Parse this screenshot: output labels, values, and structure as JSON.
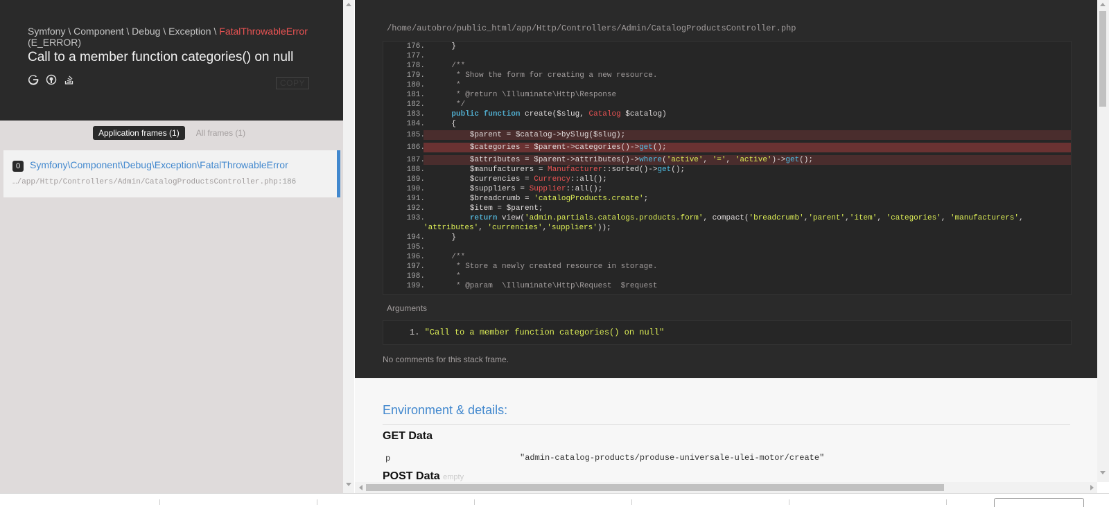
{
  "header": {
    "namespace": "Symfony \\ Component \\ Debug \\ Exception \\ ",
    "exception_name": "FatalThrowableError",
    "error_code": "(E_ERROR)",
    "message": "Call to a member function categories() on null",
    "copy_label": "COPY",
    "search_icons": [
      "google-icon",
      "duckduckgo-icon",
      "stackoverflow-icon"
    ]
  },
  "frame_tabs": {
    "application": "Application frames (1)",
    "all": "All frames (1)"
  },
  "frame": {
    "index": "0",
    "class": "Symfony\\Component\\Debug\\Exception\\FatalThrowableError",
    "file": "…/app/Http/Controllers/Admin/CatalogProductsController.php",
    "line": ":186"
  },
  "code": {
    "file_path": "/home/autobro/public_html/app/Http/Controllers/Admin/CatalogProductsController.php",
    "lines": [
      {
        "num": "176.",
        "text": "    }"
      },
      {
        "num": "177.",
        "text": ""
      },
      {
        "num": "178.",
        "text": "    /**"
      },
      {
        "num": "179.",
        "text": "     * Show the form for creating a new resource."
      },
      {
        "num": "180.",
        "text": "     *"
      },
      {
        "num": "181.",
        "text": "     * @return \\Illuminate\\Http\\Response"
      },
      {
        "num": "182.",
        "text": "     */"
      },
      {
        "num": "183.",
        "text": "    public function create($slug, Catalog $catalog)"
      },
      {
        "num": "184.",
        "text": "    {"
      },
      {
        "num": "185.",
        "text": "        $parent = $catalog->bySlug($slug);"
      },
      {
        "num": "186.",
        "text": "        $categories = $parent->categories()->get();"
      },
      {
        "num": "187.",
        "text": "        $attributes = $parent->attributes()->where('active', '=', 'active')->get();"
      },
      {
        "num": "188.",
        "text": "        $manufacturers = Manufacturer::sorted()->get();"
      },
      {
        "num": "189.",
        "text": "        $currencies = Currency::all();"
      },
      {
        "num": "190.",
        "text": "        $suppliers = Supplier::all();"
      },
      {
        "num": "191.",
        "text": "        $breadcrumb = 'catalogProducts.create';"
      },
      {
        "num": "192.",
        "text": "        $item = $parent;"
      },
      {
        "num": "193.",
        "text": "        return view('admin.partials.catalogs.products.form', compact('breadcrumb','parent','item', 'categories', 'manufacturers',"
      },
      {
        "num": "",
        "text": "'attributes', 'currencies','suppliers'));"
      },
      {
        "num": "194.",
        "text": "    }"
      },
      {
        "num": "195.",
        "text": ""
      },
      {
        "num": "196.",
        "text": "    /**"
      },
      {
        "num": "197.",
        "text": "     * Store a newly created resource in storage."
      },
      {
        "num": "198.",
        "text": "     *"
      },
      {
        "num": "199.",
        "text": "     * @param  \\Illuminate\\Http\\Request  $request"
      }
    ]
  },
  "arguments": {
    "label": "Arguments",
    "index": "1.",
    "value": "\"Call to a member function categories() on null\""
  },
  "comments": "No comments for this stack frame.",
  "environment": {
    "title": "Environment & details:",
    "get_title": "GET Data",
    "get_key": "p",
    "get_value": "\"admin-catalog-products/produse-universale-ulei-motor/create\"",
    "post_title": "POST Data",
    "post_empty": "empty"
  },
  "colors": {
    "accent": "#4288ce",
    "error_red": "#e95353",
    "dark_bg": "#2a2a2a",
    "string_yellow": "#ddee56"
  }
}
